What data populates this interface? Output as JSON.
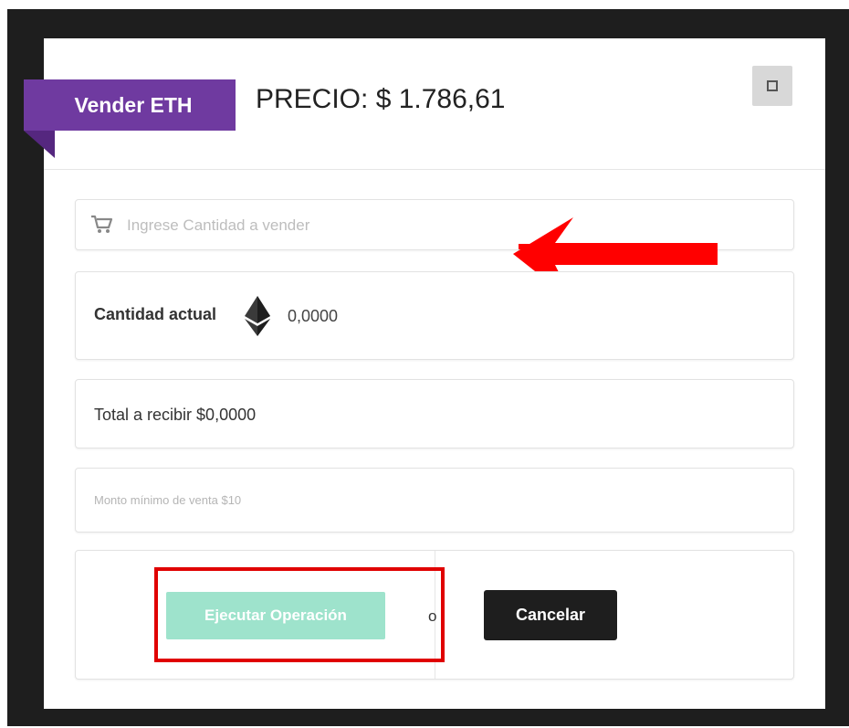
{
  "modal": {
    "ribbon_label": "Vender ETH",
    "price_label": "PRECIO: $ 1.786,61",
    "close_icon": "close-square-icon"
  },
  "form": {
    "amount_placeholder": "Ingrese Cantidad a vender",
    "cart_icon": "cart-icon",
    "current_label": "Cantidad actual",
    "current_icon": "ethereum-icon",
    "current_value": "0,0000",
    "total_label": "Total a recibir $0,0000",
    "min_notice": "Monto mínimo de venta $10"
  },
  "actions": {
    "execute_label": "Ejecutar Operación",
    "or_text": "o",
    "cancel_label": "Cancelar"
  },
  "annotations": {
    "arrow_color": "#ff0000",
    "highlight_color": "#e00000"
  },
  "colors": {
    "ribbon": "#6f3aa0",
    "execute_button": "#9ee3cc",
    "cancel_button": "#1e1e1e"
  }
}
